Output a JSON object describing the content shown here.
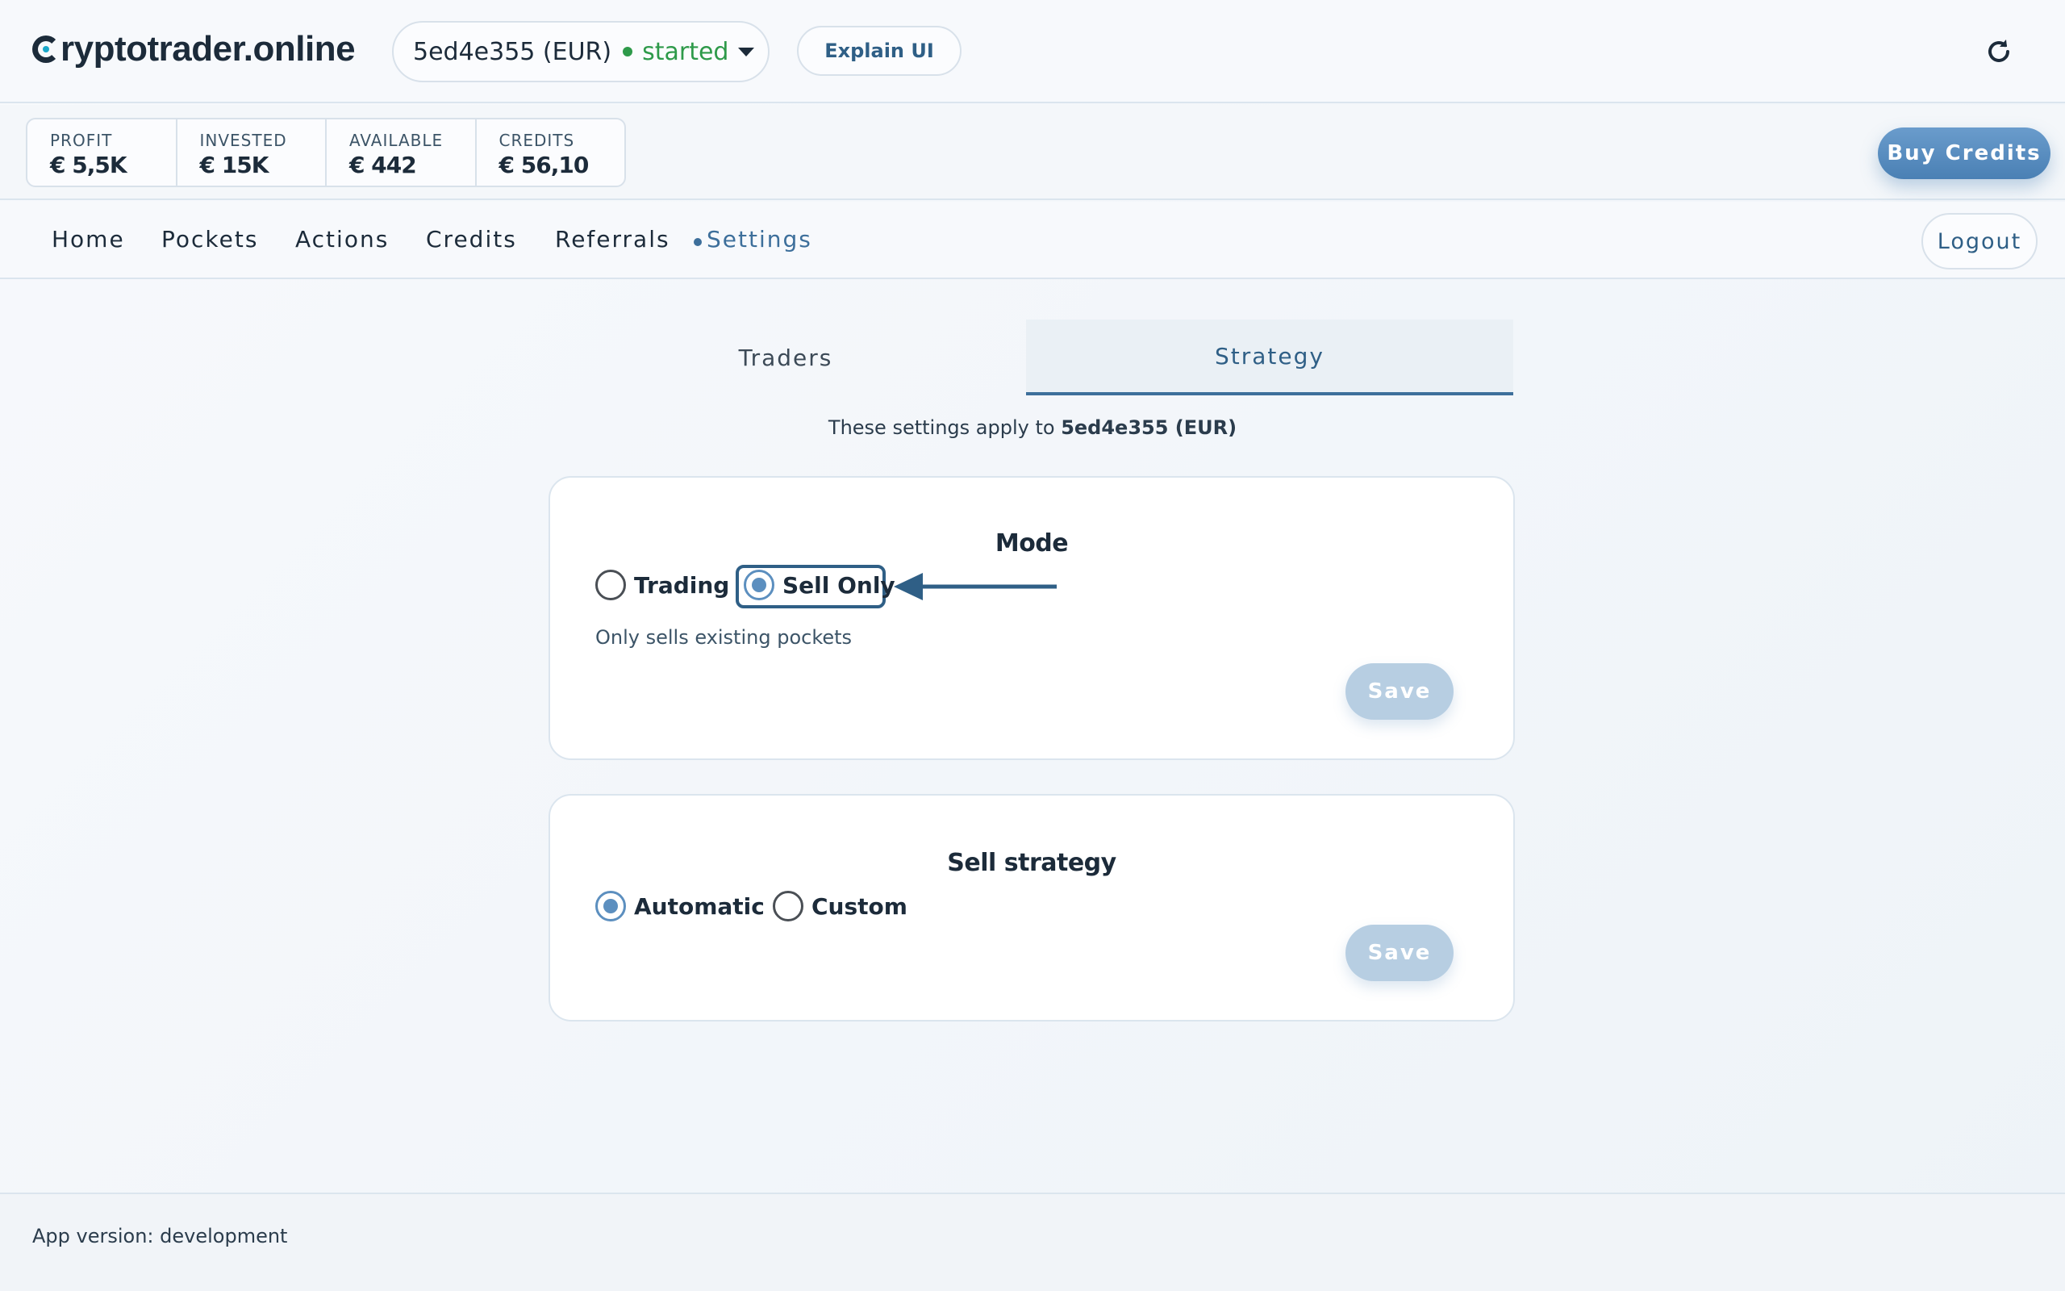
{
  "header": {
    "logo_text": "ryptotrader.online",
    "account": {
      "name": "5ed4e355 (EUR)",
      "status": "started",
      "status_color": "#2e9a4a"
    },
    "explain_label": "Explain UI",
    "refresh_icon": "refresh-icon"
  },
  "stats": [
    {
      "label": "PROFIT",
      "value": "€ 5,5K"
    },
    {
      "label": "INVESTED",
      "value": "€ 15K"
    },
    {
      "label": "AVAILABLE",
      "value": "€ 442"
    },
    {
      "label": "CREDITS",
      "value": "€ 56,10"
    }
  ],
  "buy_credits_label": "Buy Credits",
  "nav": {
    "items": [
      "Home",
      "Pockets",
      "Actions",
      "Credits",
      "Referrals",
      "Settings"
    ],
    "active": "Settings",
    "logout_label": "Logout"
  },
  "tabs": {
    "traders": "Traders",
    "strategy": "Strategy",
    "active": "Strategy"
  },
  "apply_note": {
    "prefix": "These settings apply to ",
    "account": "5ed4e355 (EUR)"
  },
  "mode_card": {
    "title": "Mode",
    "options": [
      "Trading",
      "Sell Only"
    ],
    "selected": "Sell Only",
    "hint": "Only sells existing pockets",
    "save_label": "Save"
  },
  "sell_card": {
    "title": "Sell strategy",
    "options": [
      "Automatic",
      "Custom"
    ],
    "selected": "Automatic",
    "save_label": "Save"
  },
  "footer": {
    "version_text": "App version: development"
  },
  "colors": {
    "accent": "#3d6f9b",
    "brand_dot": "#1aa7c9",
    "buy_button": "#4a80b4",
    "save_disabled": "#b7cee2"
  }
}
